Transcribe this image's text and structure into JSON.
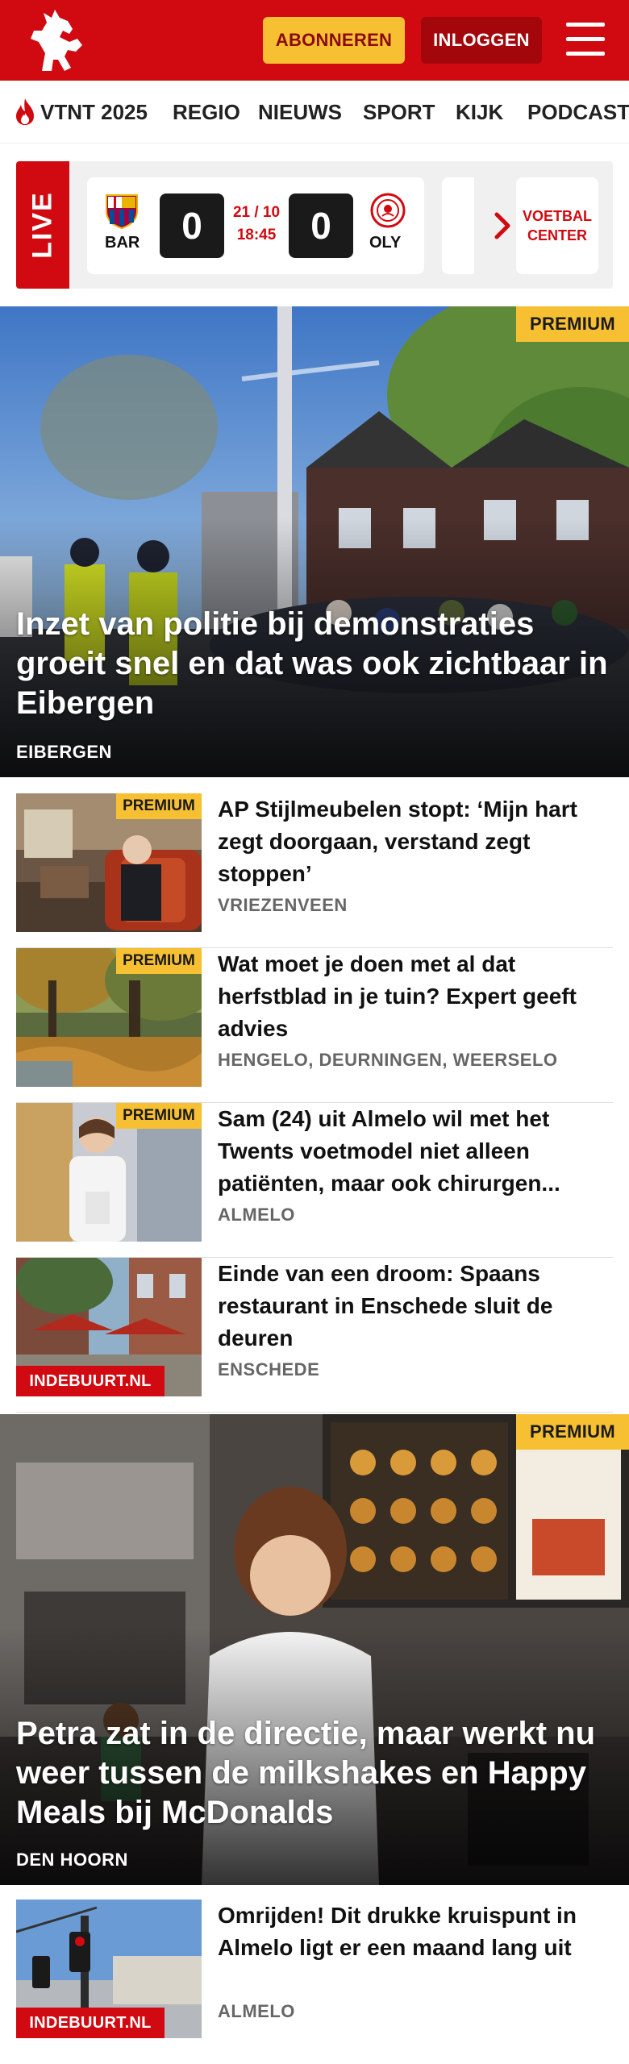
{
  "header": {
    "subscribe_label": "ABONNEREN",
    "login_label": "INLOGGEN",
    "brand_color": "#d10a11",
    "accent_color": "#f7c033",
    "logo_icon": "horse-logo-icon",
    "menu_icon": "hamburger-menu-icon"
  },
  "nav": {
    "items": [
      {
        "label": "VTNT 2025",
        "icon": "flame-icon"
      },
      {
        "label": "REGIO"
      },
      {
        "label": "NIEUWS"
      },
      {
        "label": "SPORT"
      },
      {
        "label": "KIJK"
      },
      {
        "label": "PODCAST"
      }
    ]
  },
  "live": {
    "label": "LIVE",
    "match": {
      "home_team": "BAR",
      "home_score": "0",
      "away_team": "OLY",
      "away_score": "0",
      "date": "21 / 10",
      "time": "18:45"
    },
    "voetbal_center": "VOETBAL CENTER"
  },
  "hero1": {
    "badge": "PREMIUM",
    "headline": "Inzet van politie bij demonstraties groeit snel en dat was ook zichtbaar in Eibergen",
    "location": "EIBERGEN"
  },
  "articles": [
    {
      "badge": "PREMIUM",
      "title": "AP Stijlmeubelen stopt: ‘Mijn hart zegt doorgaan, verstand zegt stoppen’",
      "location": "VRIEZENVEEN"
    },
    {
      "badge": "PREMIUM",
      "title": "Wat moet je doen met al dat herfstblad in je tuin? Expert geeft advies",
      "location": "HENGELO, DEURNINGEN, WEERSELO"
    },
    {
      "badge": "PREMIUM",
      "title": "Sam (24) uit Almelo wil met het Twents voetmodel niet alleen patiënten, maar ook chirurgen...",
      "location": "ALMELO"
    },
    {
      "partner": "INDEBUURT.NL",
      "title": "Einde van een droom: Spaans restaurant in Enschede sluit de deuren",
      "location": "ENSCHEDE"
    }
  ],
  "hero2": {
    "badge": "PREMIUM",
    "headline": "Petra zat in de directie, maar werkt nu weer tussen de milkshakes en Happy Meals bij McDonalds",
    "location": "DEN HOORN"
  },
  "articles2": [
    {
      "partner": "INDEBUURT.NL",
      "title": "Omrijden! Dit drukke kruispunt in Almelo ligt er een maand lang uit",
      "location": "ALMELO"
    }
  ]
}
